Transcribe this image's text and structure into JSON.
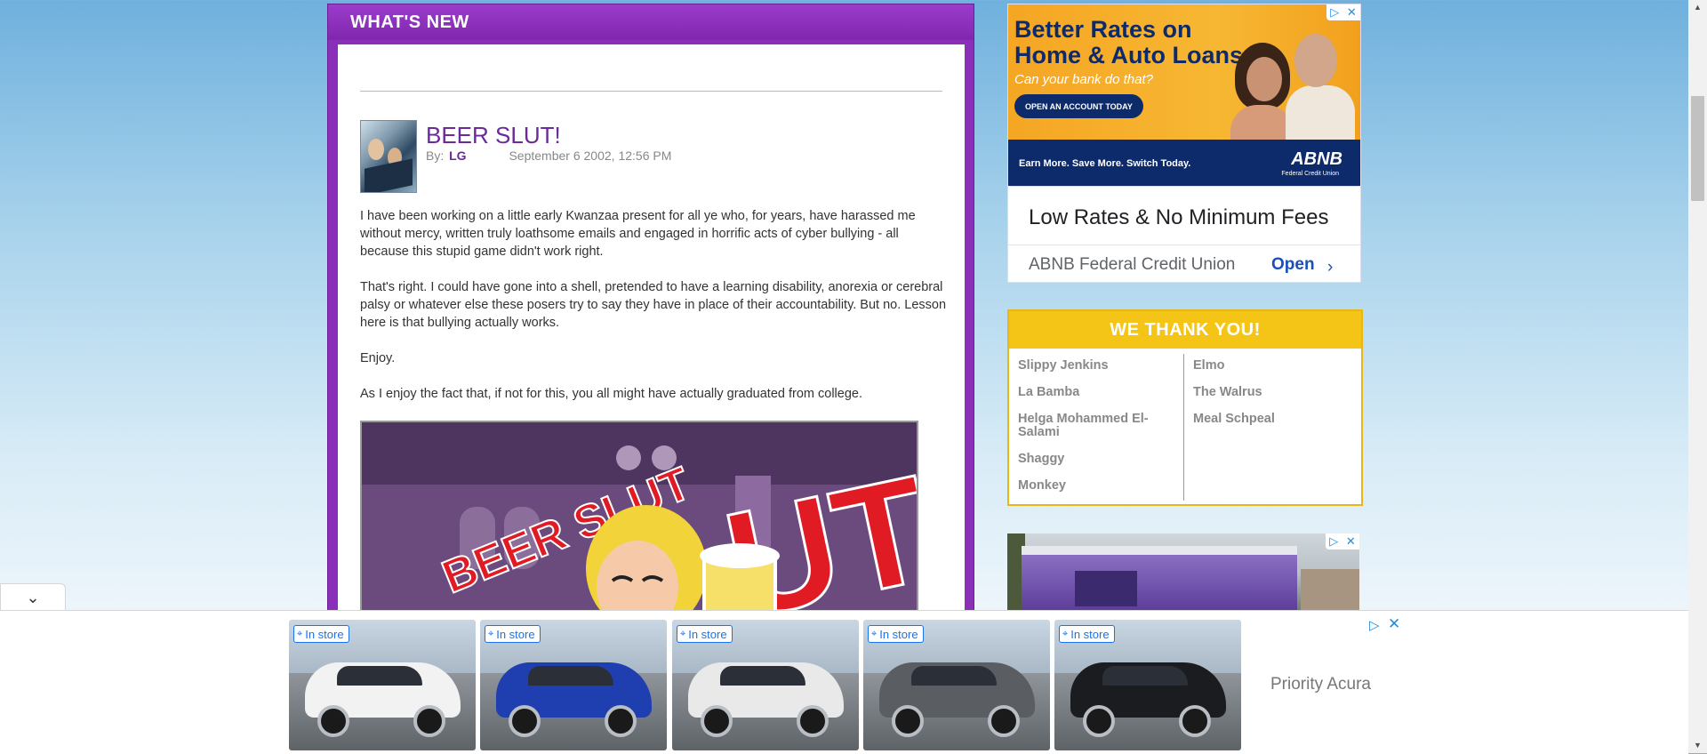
{
  "main": {
    "section_title": "WHAT'S NEW",
    "post": {
      "title": "BEER SLUT!",
      "by_label": "By:",
      "author": "LG",
      "date": "September 6 2002, 12:56 PM",
      "paragraphs": [
        "I have been working on a little early Kwanzaa present for all ye who, for years, have harassed me without mercy, written truly loathsome emails and engaged in horrific acts of cyber bullying - all because this stupid game didn't work right.",
        "That's right. I could have gone into a shell, pretended to have a learning disability, anorexia or cerebral palsy or whatever else these posers try to say they have in place of their accountability. But no. Lesson here is that bullying actually works.",
        "Enjoy.",
        "As I enjoy the fact that, if not for this, you all might have actually graduated from college."
      ],
      "image_text": "BEER SLUT"
    }
  },
  "right_ad": {
    "headline_line1": "Better Rates on",
    "headline_line2": "Home & Auto Loans",
    "subhead": "Can your bank do that?",
    "cta": "OPEN AN ACCOUNT TODAY",
    "slogan": "Earn More. Save More. Switch Today.",
    "logo": "ABNB",
    "logo_sub": "Federal Credit Union",
    "big_text": "Low Rates & No Minimum Fees",
    "advertiser": "ABNB Federal Credit Union",
    "open_label": "Open"
  },
  "thank_you": {
    "title": "WE THANK YOU!",
    "left": [
      "Slippy Jenkins",
      "La Bamba",
      "Helga Mohammed El-Salami",
      "Shaggy",
      "Monkey"
    ],
    "right": [
      "Elmo",
      "The Walrus",
      "Meal Schpeal"
    ]
  },
  "bottom_ad": {
    "badge_label": "In store",
    "cars": [
      {
        "color": "#f2f2f2"
      },
      {
        "color": "#1f3fb0"
      },
      {
        "color": "#e9e9e9"
      },
      {
        "color": "#5a5d62"
      },
      {
        "color": "#1b1c1f"
      }
    ],
    "dealer": "Priority Acura"
  },
  "colors": {
    "panel_purple": "#8a2fb8",
    "title_purple": "#6a2a9a",
    "thank_yellow": "#f4c516",
    "ad_navy": "#0d2a6b"
  }
}
